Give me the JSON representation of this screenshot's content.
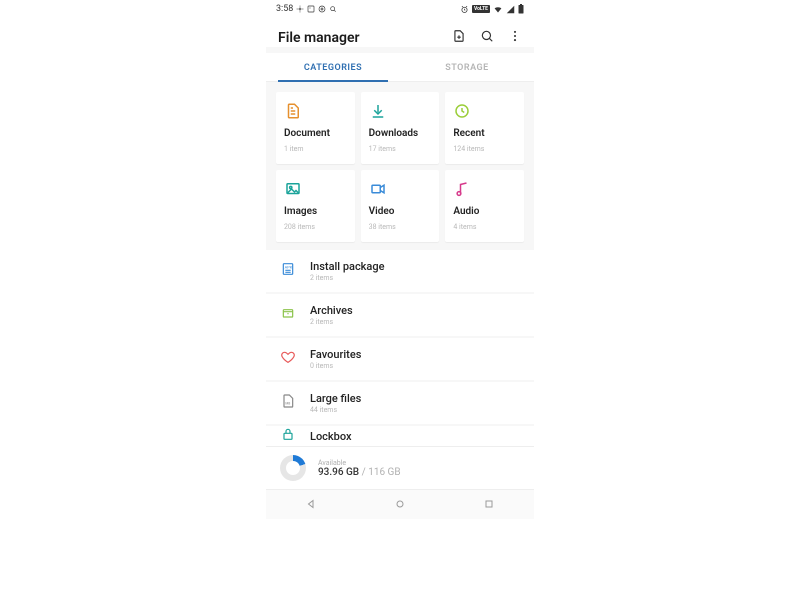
{
  "status": {
    "time": "3:58",
    "network_badge": "VoLTE"
  },
  "header": {
    "title": "File manager"
  },
  "tabs": {
    "categories": "CATEGORIES",
    "storage": "STORAGE"
  },
  "cards": {
    "document": {
      "title": "Document",
      "sub": "1 item"
    },
    "downloads": {
      "title": "Downloads",
      "sub": "17 items"
    },
    "recent": {
      "title": "Recent",
      "sub": "124 items"
    },
    "images": {
      "title": "Images",
      "sub": "208 items"
    },
    "video": {
      "title": "Video",
      "sub": "38 items"
    },
    "audio": {
      "title": "Audio",
      "sub": "4 items"
    }
  },
  "list": {
    "install": {
      "title": "Install package",
      "sub": "2 items"
    },
    "archives": {
      "title": "Archives",
      "sub": "2 items"
    },
    "favourites": {
      "title": "Favourites",
      "sub": "0 items"
    },
    "large": {
      "title": "Large files",
      "sub": "44 items"
    },
    "lockbox": {
      "title": "Lockbox"
    }
  },
  "storage": {
    "label": "Available",
    "free": "93.96 GB",
    "sep": " / ",
    "total": "116 GB"
  }
}
